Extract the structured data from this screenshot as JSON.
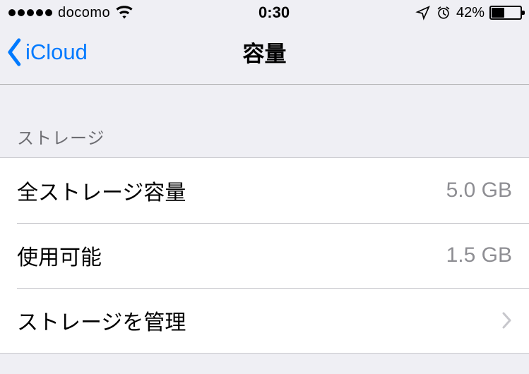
{
  "statusbar": {
    "carrier": "docomo",
    "time": "0:30",
    "battery_pct": "42%"
  },
  "nav": {
    "back_label": "iCloud",
    "title": "容量"
  },
  "section": {
    "header": "ストレージ"
  },
  "rows": {
    "total": {
      "label": "全ストレージ容量",
      "value": "5.0 GB"
    },
    "available": {
      "label": "使用可能",
      "value": "1.5 GB"
    },
    "manage": {
      "label": "ストレージを管理"
    }
  }
}
